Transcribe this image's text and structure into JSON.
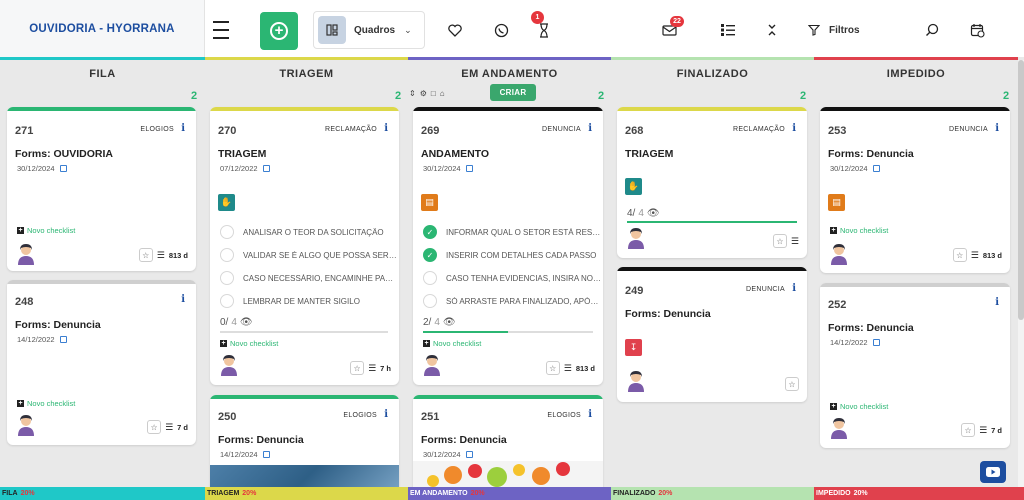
{
  "app": {
    "title": "OUVIDORIA - HYORRANA"
  },
  "toolbar": {
    "board_label": "Quadros",
    "filters_label": "Filtros",
    "hourglass_badge": "1",
    "mail_badge": "22"
  },
  "colors": {
    "fila": "#1fc8c8",
    "triagem": "#dcd84a",
    "andamento": "#6d63c4",
    "finalizado": "#b5e3b0",
    "impedido": "#e0414d",
    "green": "#2bb673",
    "blue": "#1d4ea0"
  },
  "columns": [
    {
      "title": "FILA",
      "count": "2"
    },
    {
      "title": "TRIAGEM",
      "count": "2"
    },
    {
      "title": "EM ANDAMENTO",
      "count": "2"
    },
    {
      "title": "FINALIZADO",
      "count": "2"
    },
    {
      "title": "IMPEDIDO",
      "count": "2"
    }
  ],
  "criar_label": "CRIAR",
  "cards": {
    "c271": {
      "num": "271",
      "cat": "ELOGIOS",
      "title": "Forms: OUVIDORIA",
      "date": "30/12/2024",
      "novo": "Novo checklist",
      "age": "813 d"
    },
    "c248": {
      "num": "248",
      "cat": "",
      "title": "Forms: Denuncia",
      "date": "14/12/2022",
      "novo": "Novo checklist",
      "age": "7 d"
    },
    "c270": {
      "num": "270",
      "cat": "RECLAMAÇÃO",
      "title": "TRIAGEM",
      "date": "07/12/2022",
      "checklist": [
        "ANALISAR O TEOR DA SOLICITAÇÃO",
        "VALIDAR SE É ALGO QUE POSSA SER RESOLVIDO",
        "CASO NECESSÁRIO, ENCAMINHE PARA O SETOR",
        "LEMBRAR DE MANTER SIGILO"
      ],
      "prog_done": "0/",
      "prog_total": "4",
      "progress": 0,
      "novo": "Novo checklist",
      "age": "7 h"
    },
    "c250": {
      "num": "250",
      "cat": "ELOGIOS",
      "title": "Forms: Denuncia",
      "date": "14/12/2024"
    },
    "c269": {
      "num": "269",
      "cat": "DENUNCIA",
      "title": "ANDAMENTO",
      "date": "30/12/2024",
      "checklist": [
        "INFORMAR QUAL O SETOR ESTÁ RESPONSÁVEL",
        "INSERIR COM DETALHES CADA PASSO",
        "CASO TENHA EVIDENCIAS, INSIRA NO CARD",
        "SÓ ARRASTE PARA FINALIZADO, APÓS CONCLUIR"
      ],
      "prog_done": "2/",
      "prog_total": "4",
      "progress": 0.5,
      "novo": "Novo checklist",
      "age": "813 d"
    },
    "c251": {
      "num": "251",
      "cat": "ELOGIOS",
      "title": "Forms: Denuncia",
      "date": "30/12/2024"
    },
    "c268": {
      "num": "268",
      "cat": "RECLAMAÇÃO",
      "title": "TRIAGEM",
      "prog_done": "4/",
      "prog_total": "4",
      "progress": 1
    },
    "c249": {
      "num": "249",
      "cat": "DENUNCIA",
      "title": "Forms: Denuncia"
    },
    "c253": {
      "num": "253",
      "cat": "DENUNCIA",
      "title": "Forms: Denuncia",
      "date": "30/12/2024",
      "novo": "Novo checklist",
      "age": "813 d"
    },
    "c252": {
      "num": "252",
      "cat": "",
      "title": "Forms: Denuncia",
      "date": "14/12/2022",
      "novo": "Novo checklist",
      "age": "7 d"
    }
  },
  "status": [
    {
      "label": "FILA",
      "pct": "20%"
    },
    {
      "label": "TRIAGEM",
      "pct": "20%"
    },
    {
      "label": "EM ANDAMENTO",
      "pct": "20%"
    },
    {
      "label": "FINALIZADO",
      "pct": "20%"
    },
    {
      "label": "IMPEDIDO",
      "pct": "20%"
    }
  ]
}
